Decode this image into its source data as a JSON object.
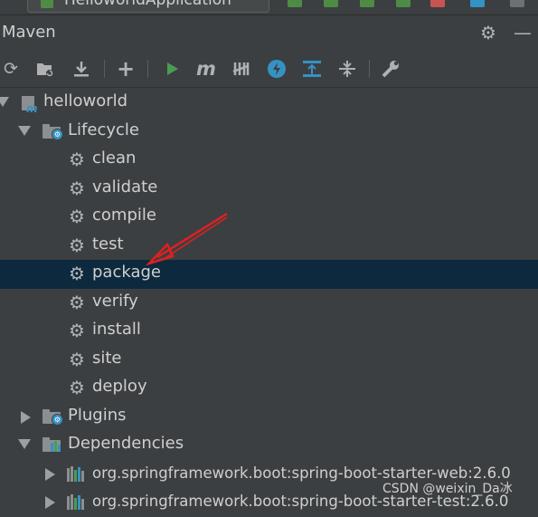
{
  "toolbar_top": {
    "run_config_label": "HelloworldApplication"
  },
  "panel": {
    "title": "Maven",
    "settings_icon": "gear-icon",
    "hide_icon": "minimize-icon"
  },
  "maven_toolbar": [
    {
      "name": "reload-all-projects-button",
      "icon": "reload-icon"
    },
    {
      "name": "generate-sources-button",
      "icon": "folder-reload-icon"
    },
    {
      "name": "download-sources-button",
      "icon": "download-icon"
    },
    {
      "name": "add-maven-project-button",
      "icon": "plus-icon"
    },
    {
      "name": "run-maven-build-button",
      "icon": "play-icon"
    },
    {
      "name": "execute-maven-goal-button",
      "icon": "m-icon"
    },
    {
      "name": "toggle-offline-mode-button",
      "icon": "offline-icon"
    },
    {
      "name": "skip-tests-button",
      "icon": "lightning-icon"
    },
    {
      "name": "show-dependencies-button",
      "icon": "diagram-icon"
    },
    {
      "name": "collapse-all-button",
      "icon": "collapse-icon"
    },
    {
      "name": "maven-settings-button",
      "icon": "wrench-icon"
    }
  ],
  "tree": {
    "project": "helloworld",
    "lifecycle_label": "Lifecycle",
    "lifecycle_goals": [
      "clean",
      "validate",
      "compile",
      "test",
      "package",
      "verify",
      "install",
      "site",
      "deploy"
    ],
    "selected_goal": "package",
    "plugins_label": "Plugins",
    "dependencies_label": "Dependencies",
    "dependencies": [
      "org.springframework.boot:spring-boot-starter-web:2.6.0",
      "org.springframework.boot:spring-boot-starter-test:2.6.0"
    ]
  },
  "watermark": "CSDN @weixin_Da冰",
  "colors": {
    "background": "#3c3f41",
    "selection": "#0d293e",
    "run_green": "#499c54",
    "accent_blue": "#3592c4",
    "annotation_red": "#e02020"
  }
}
